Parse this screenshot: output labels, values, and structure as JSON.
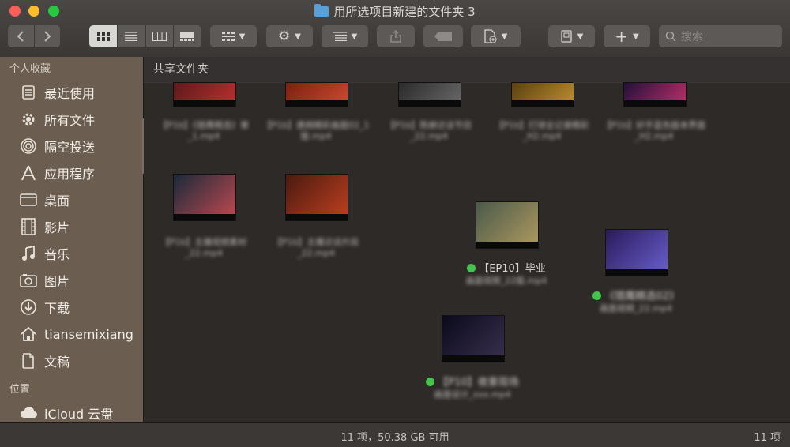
{
  "window": {
    "title": "用所选项目新建的文件夹 3"
  },
  "toolbar": {
    "search_placeholder": "搜索"
  },
  "sidebar": {
    "favorites_header": "个人收藏",
    "items": [
      {
        "label": "最近使用",
        "icon": "recent-icon"
      },
      {
        "label": "所有文件",
        "icon": "gear-icon"
      },
      {
        "label": "隔空投送",
        "icon": "airdrop-icon"
      },
      {
        "label": "应用程序",
        "icon": "applications-icon"
      },
      {
        "label": "桌面",
        "icon": "desktop-icon"
      },
      {
        "label": "影片",
        "icon": "movies-icon"
      },
      {
        "label": "音乐",
        "icon": "music-icon"
      },
      {
        "label": "图片",
        "icon": "pictures-icon"
      },
      {
        "label": "下载",
        "icon": "download-icon"
      },
      {
        "label": "tiansemixiang",
        "icon": "home-icon"
      },
      {
        "label": "文稿",
        "icon": "documents-icon"
      }
    ],
    "locations_header": "位置",
    "locations": [
      {
        "label": "iCloud 云盘",
        "icon": "cloud-icon"
      }
    ]
  },
  "content": {
    "path_title": "共享文件夹",
    "files": [
      {
        "label": "【P1b】《猎鹰精选》第_1.mp4",
        "tagged": false,
        "colors": [
          "#5a1a1a",
          "#c03030"
        ]
      },
      {
        "label": "【P1b】唐嫣精彩画面02_1版.mp4",
        "tagged": false,
        "colors": [
          "#7a2010",
          "#d04a30"
        ]
      },
      {
        "label": "【P1b】陈赫访谈节目_22.mp4",
        "tagged": false,
        "colors": [
          "#2a2a2a",
          "#6a6a6a"
        ]
      },
      {
        "label": "【P1b】打球全记录精彩_H2.mp4",
        "tagged": false,
        "colors": [
          "#5a4010",
          "#c09030"
        ]
      },
      {
        "label": "【P1b】好手蓝色版本界面_H2.mp4",
        "tagged": false,
        "colors": [
          "#20103a",
          "#c0306a"
        ]
      },
      {
        "label": "【P1b】主播视频素材_22.mp4",
        "tagged": false,
        "colors": [
          "#1a2a3a",
          "#c04a50"
        ]
      },
      {
        "label": "【P1b】主播访谈片段_22.mp4",
        "tagged": false,
        "colors": [
          "#4a1a10",
          "#c04020"
        ]
      },
      {
        "label": "【EP10】毕业",
        "sub": "画面视频_22版.mp4",
        "tagged": true,
        "colors": [
          "#4a5a4a",
          "#b09a60"
        ]
      },
      {
        "label": "《猎鹰精选02》",
        "sub": "画面视频_22.mp4",
        "tagged": true,
        "colors": [
          "#2a1a5a",
          "#6a60d0"
        ]
      },
      {
        "label": "【P10】夜景现场",
        "sub": "画面设计_xxx.mp4",
        "tagged": true,
        "colors": [
          "#0a0a1a",
          "#3a3050"
        ]
      }
    ]
  },
  "status": {
    "summary": "11 项，50.38 GB 可用",
    "right": "11 项"
  }
}
